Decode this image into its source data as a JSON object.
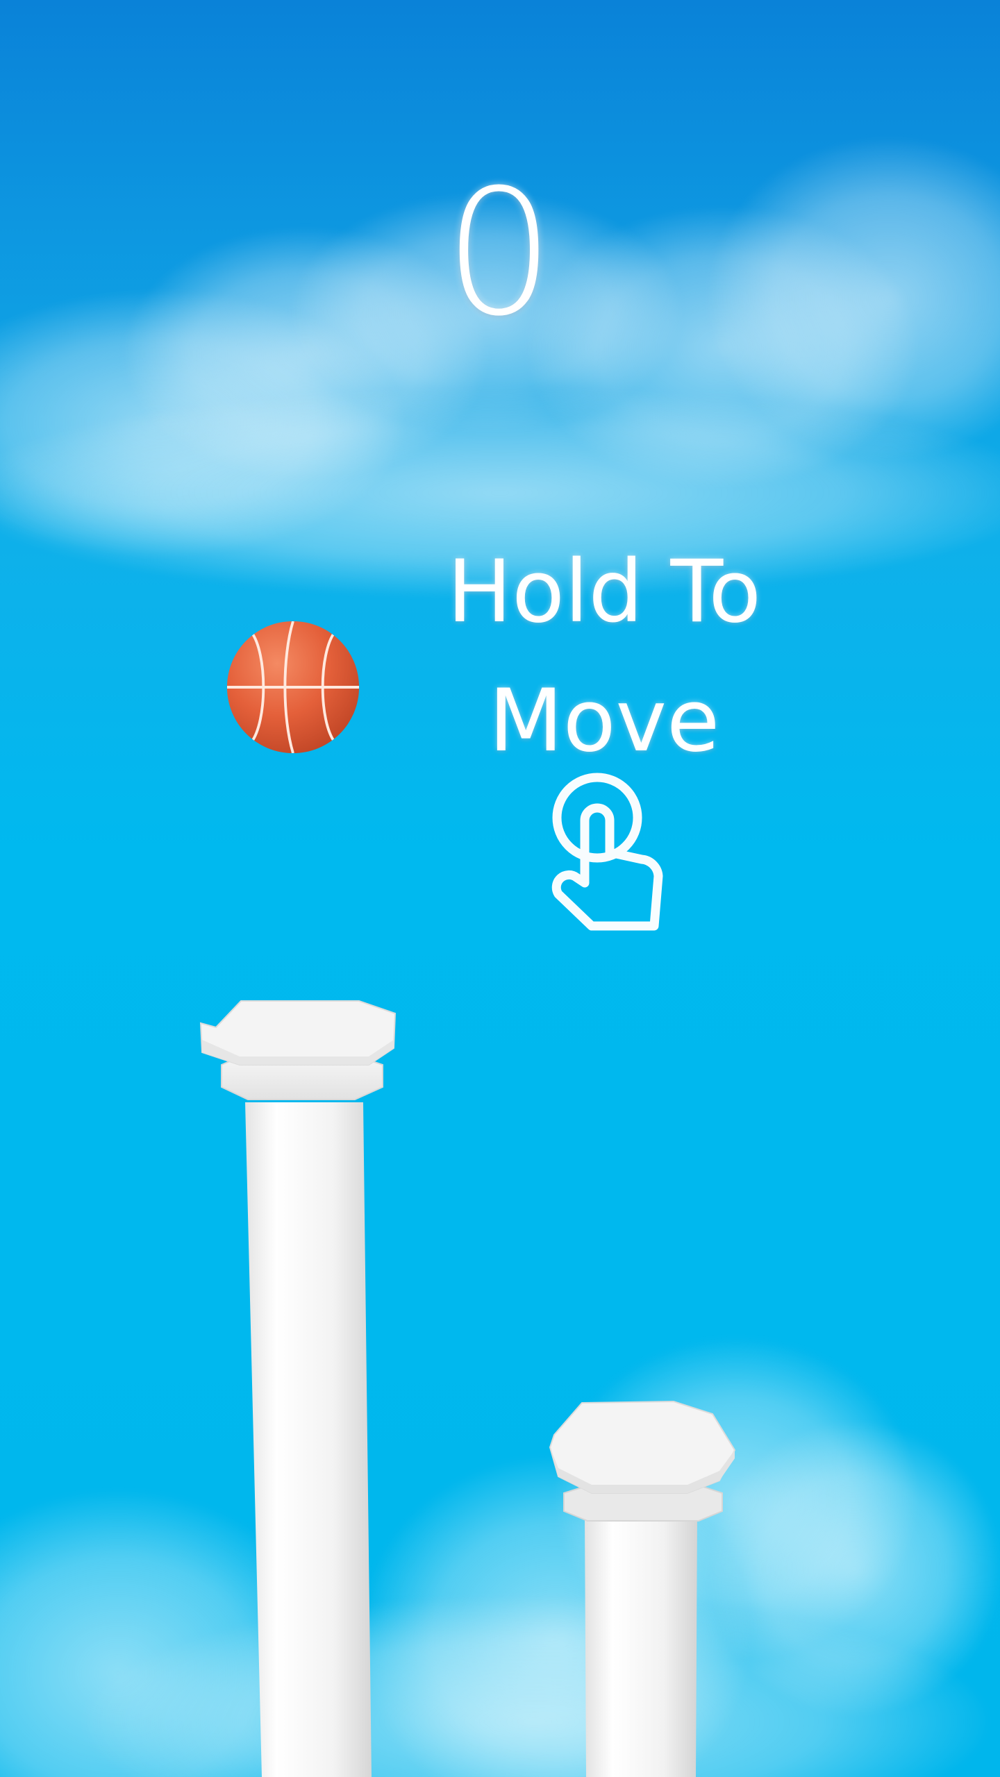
{
  "game": {
    "score": "0",
    "hint_line1": "Hold To",
    "hint_line2": "Move"
  },
  "icons": {
    "tap": "tap-hand-icon",
    "ball": "basketball"
  },
  "colors": {
    "sky_top": "#0a82d8",
    "sky_bottom": "#00b6ec",
    "ball": "#e8643e",
    "pillar": "#f2f2f2",
    "text": "#ffffff"
  }
}
